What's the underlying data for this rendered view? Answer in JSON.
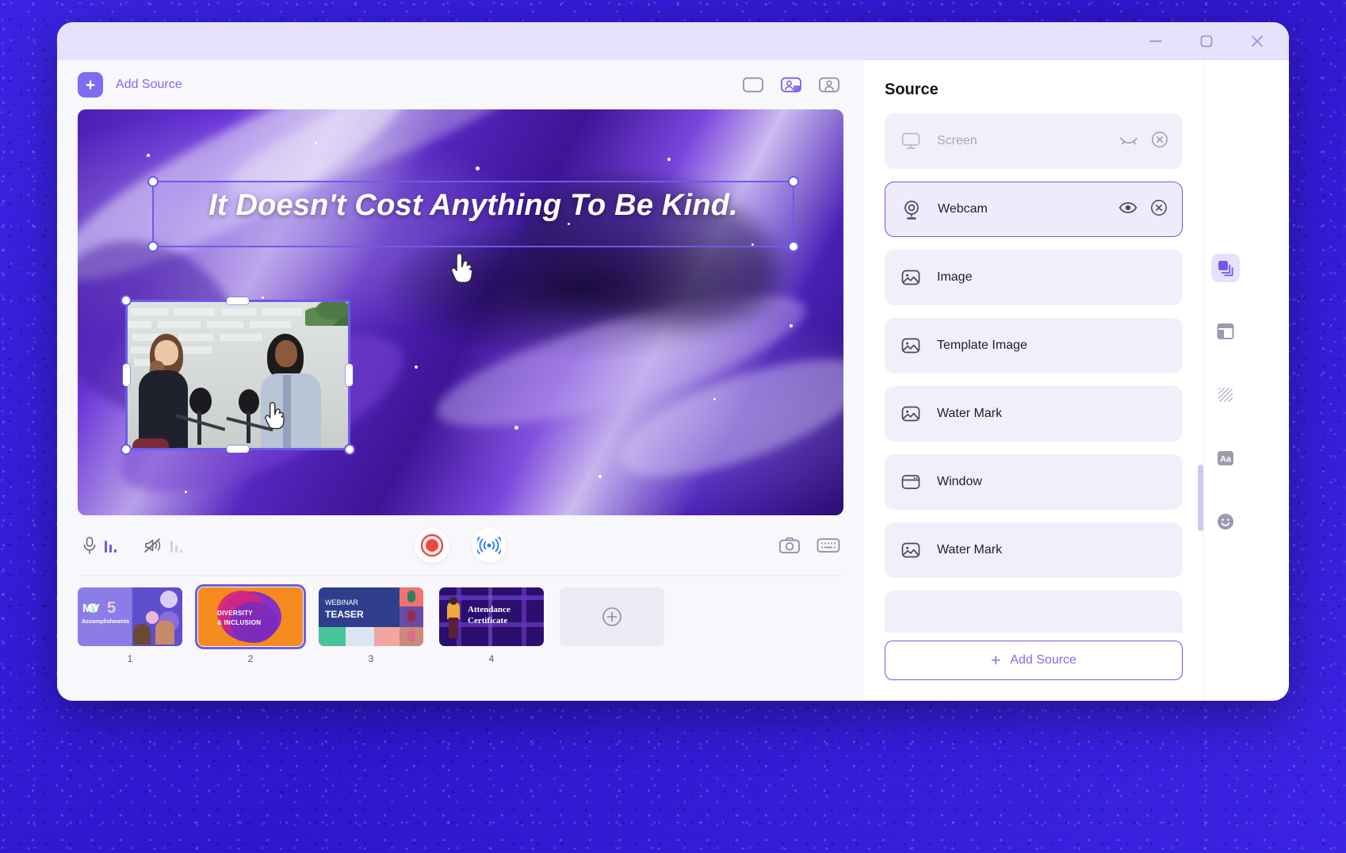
{
  "window": {
    "controls": [
      {
        "name": "minimize",
        "glyph": "—"
      },
      {
        "name": "maximize",
        "glyph": "▢"
      },
      {
        "name": "close",
        "glyph": "✕"
      }
    ],
    "titlebar_color": "#e6e2fb"
  },
  "theme": {
    "accent": "#6c5ce7",
    "accent_light": "#7c6cf0",
    "panel_bg": "#f0effa",
    "app_bg": "#f7f7fc",
    "record_red": "#f4453d",
    "live_blue": "#2f7df6",
    "backdrop": "#3420df"
  },
  "toolbar": {
    "add_source_label": "Add Source",
    "add_source_plus": "+",
    "view_modes": [
      {
        "name": "layout-single",
        "label": "Single view",
        "active": false
      },
      {
        "name": "layout-split",
        "label": "Split view",
        "active": true
      },
      {
        "name": "layout-portrait",
        "label": "Portrait view",
        "active": false
      }
    ]
  },
  "canvas": {
    "headline": "It Doesn't Cost Anything To Be Kind.",
    "headline_selected": true,
    "pip_label": "Webcam preview",
    "cursor_icons": [
      "pointing-hand",
      "pointing-hand"
    ]
  },
  "controls": {
    "mic": {
      "name": "microphone",
      "muted": false,
      "level_color": "#6c5ce7"
    },
    "speaker": {
      "name": "speaker-muted",
      "muted": true,
      "level_color": "#c9c9d4"
    },
    "record": {
      "name": "record-button",
      "label": "Record"
    },
    "live": {
      "name": "live-stream-button",
      "label": "Live"
    },
    "screenshot": {
      "name": "camera-button",
      "label": "Screenshot"
    },
    "keyboard": {
      "name": "keyboard-button",
      "label": "Shortcuts"
    }
  },
  "thumbnails": {
    "items": [
      {
        "num": "1",
        "title_line1": "MY",
        "title_big": "5",
        "title_line2": "Accomplishments",
        "selected": false
      },
      {
        "num": "2",
        "title_line1": "DIVERSITY",
        "title_line2": "& INCLUSION",
        "selected": true
      },
      {
        "num": "3",
        "title_line1": "WEBINAR",
        "title_line2": "TEASER",
        "selected": false
      },
      {
        "num": "4",
        "title_line1": "Attendance",
        "title_line2": "Certificate",
        "selected": false
      }
    ],
    "add_slide": {
      "name": "add-slide-button",
      "glyph": "+"
    }
  },
  "source_panel": {
    "title": "Source",
    "items": [
      {
        "label": "Screen",
        "icon": "monitor-icon",
        "visible": false,
        "selected": false,
        "has_actions": true,
        "eye": "eye-off-icon",
        "close": "close-circle-icon"
      },
      {
        "label": "Webcam",
        "icon": "webcam-icon",
        "visible": true,
        "selected": true,
        "has_actions": true,
        "eye": "eye-icon",
        "close": "close-circle-icon"
      },
      {
        "label": "Image",
        "icon": "image-icon",
        "visible": true,
        "selected": false,
        "has_actions": false
      },
      {
        "label": "Template Image",
        "icon": "image-icon",
        "visible": true,
        "selected": false,
        "has_actions": false
      },
      {
        "label": "Water Mark",
        "icon": "image-icon",
        "visible": true,
        "selected": false,
        "has_actions": false
      },
      {
        "label": "Window",
        "icon": "window-icon",
        "visible": true,
        "selected": false,
        "has_actions": false
      },
      {
        "label": "Water Mark",
        "icon": "image-icon",
        "visible": true,
        "selected": false,
        "has_actions": false
      }
    ],
    "add_button": {
      "label": "Add Source",
      "glyph": "+"
    }
  },
  "rail": {
    "items": [
      {
        "name": "layers-icon",
        "label": "Layers",
        "active": true
      },
      {
        "name": "template-layout-icon",
        "label": "Templates",
        "active": false
      },
      {
        "name": "texture-icon",
        "label": "Background",
        "active": false
      },
      {
        "name": "text-aa-icon",
        "label": "Text",
        "active": false
      },
      {
        "name": "sticker-smiley-icon",
        "label": "Stickers",
        "active": false
      }
    ]
  }
}
